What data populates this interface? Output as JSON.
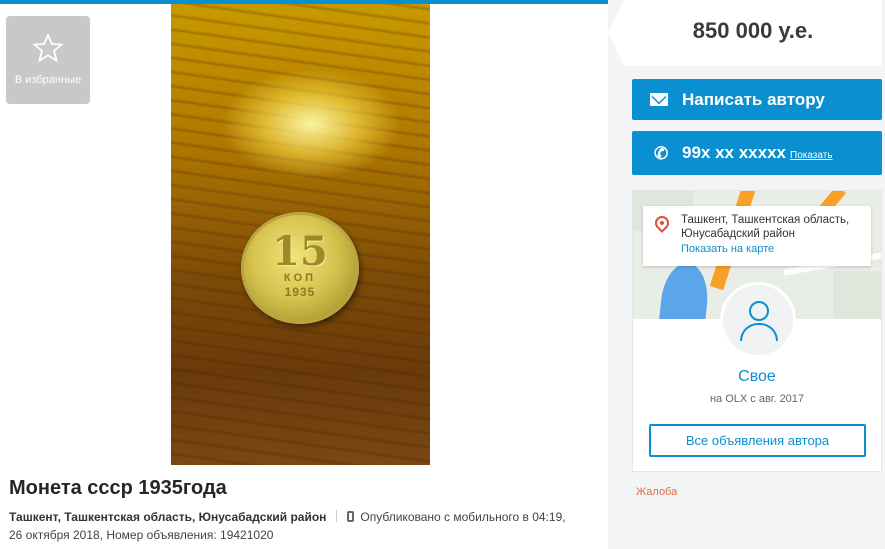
{
  "favorite": {
    "label": "В избранные",
    "icon": "star-icon"
  },
  "listing": {
    "title": "Монета ссср 1935года",
    "location": "Ташкент, Ташкентская область, Юнусабадский район",
    "published": "Опубликовано с мобильного   в 04:19,",
    "date_id": "26 октября 2018, Номер объявления: 19421020",
    "photo": {
      "coin_value": "15",
      "coin_unit": "КОП",
      "coin_year": "1935"
    }
  },
  "sidebar": {
    "price": "850 000 у.е.",
    "message_button": "Написать автору",
    "phone": {
      "number": "99x xx xxxxx",
      "show_label": "Показать"
    },
    "map": {
      "address": "Ташкент, Ташкентская область, Юнусабадский район",
      "show_on_map": "Показать на карте"
    },
    "author": {
      "name": "Свое",
      "since": "на OLX с авг. 2017",
      "all_ads": "Все объявления автора"
    },
    "report": "Жалоба"
  },
  "colors": {
    "accent": "#0a8fd1",
    "report": "#e06a4b",
    "pin": "#e04f3a"
  }
}
